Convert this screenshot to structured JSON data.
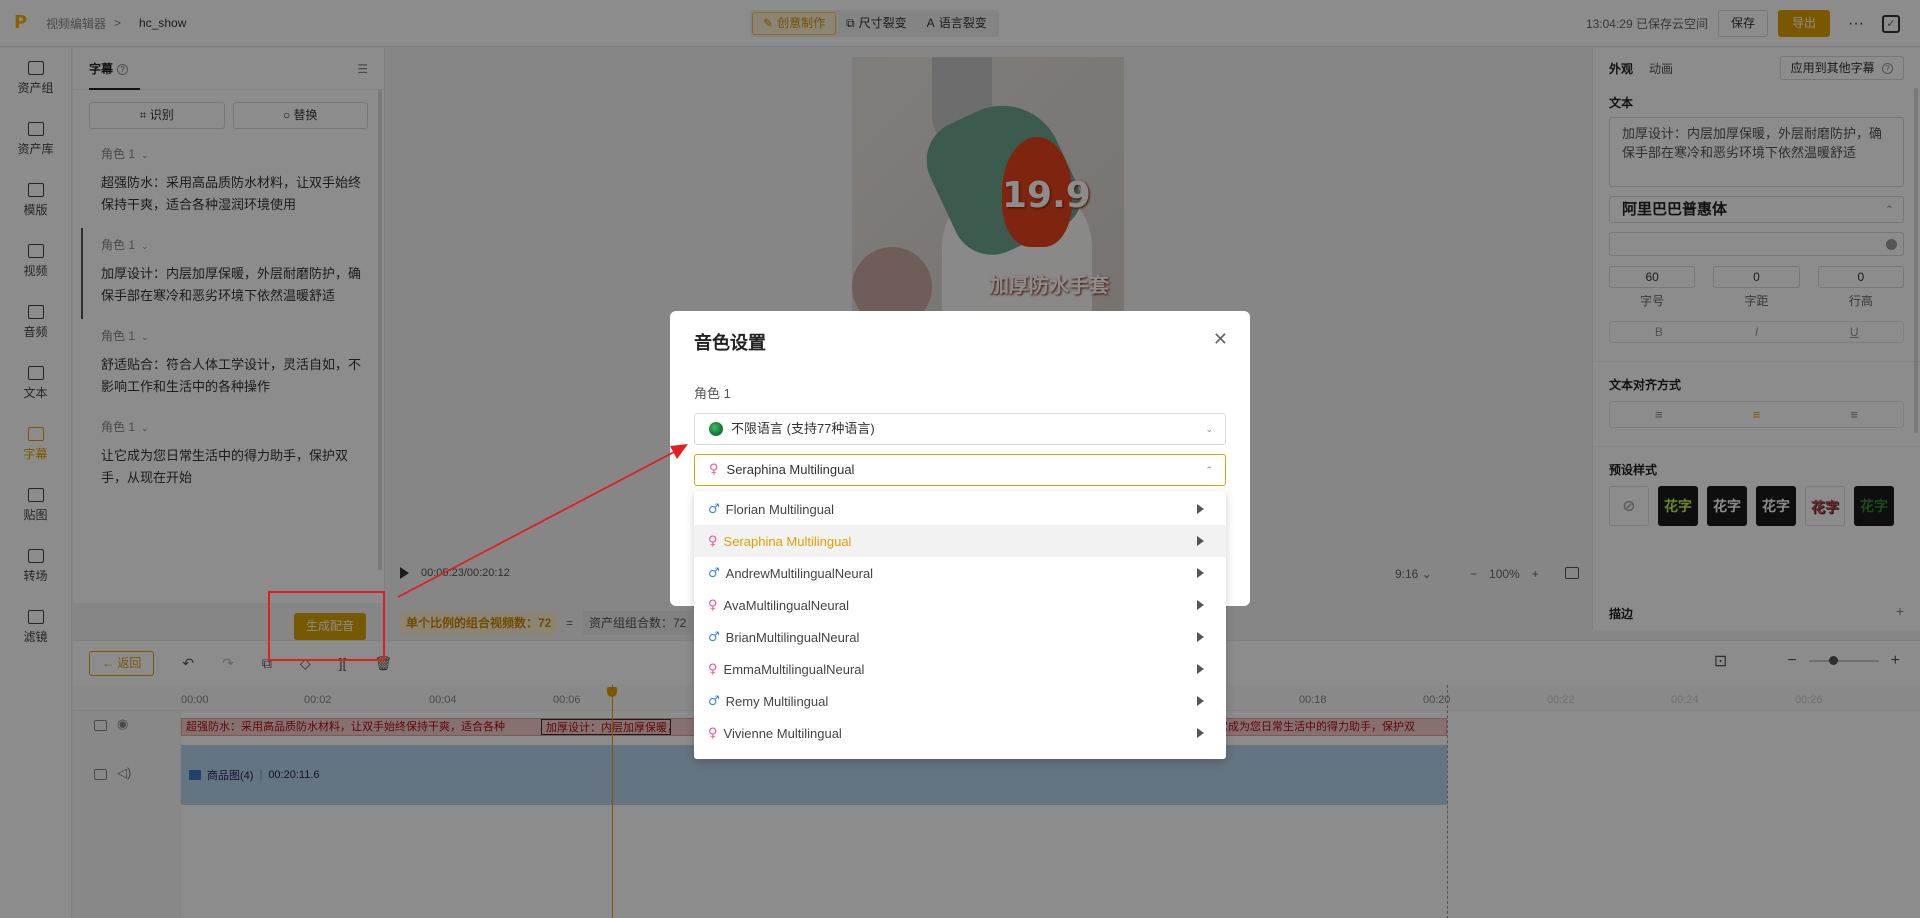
{
  "topbar": {
    "breadcrumb_root": "视频编辑器",
    "breadcrumb_sep": ">",
    "project_name": "hc_show",
    "mode_tabs": [
      {
        "label": "创意制作",
        "icon": "sparkle-icon",
        "active": true
      },
      {
        "label": "尺寸裂变",
        "icon": "resize-icon",
        "active": false
      },
      {
        "label": "语言裂变",
        "icon": "translate-icon",
        "active": false
      }
    ],
    "save_status": "13:04:29 已保存云空间",
    "save_label": "保存",
    "export_label": "导出",
    "more_label": "···"
  },
  "rail": [
    {
      "label": "资产组",
      "icon": "folder-icon"
    },
    {
      "label": "资产库",
      "icon": "library-icon"
    },
    {
      "label": "模版",
      "icon": "template-icon"
    },
    {
      "label": "视频",
      "icon": "film-icon"
    },
    {
      "label": "音频",
      "icon": "music-icon"
    },
    {
      "label": "文本",
      "icon": "text-icon"
    },
    {
      "label": "字幕",
      "icon": "subtitle-icon",
      "active": true
    },
    {
      "label": "贴图",
      "icon": "sticker-icon"
    },
    {
      "label": "转场",
      "icon": "transition-icon"
    },
    {
      "label": "滤镜",
      "icon": "filter-icon"
    }
  ],
  "subtitles": {
    "tab_label": "字幕",
    "recognize_label": "识别",
    "replace_label": "替换",
    "items": [
      {
        "role": "角色 1",
        "text": "超强防水：采用高品质防水材料，让双手始终保持干爽，适合各种湿润环境使用"
      },
      {
        "role": "角色 1",
        "text": "加厚设计：内层加厚保暖，外层耐磨防护，确保手部在寒冷和恶劣环境下依然温暖舒适"
      },
      {
        "role": "角色 1",
        "text": "舒适贴合：符合人体工学设计，灵活自如，不影响工作和生活中的各种操作"
      },
      {
        "role": "角色 1",
        "text": "让它成为您日常生活中的得力助手，保护双手，从现在开始"
      }
    ]
  },
  "preview": {
    "price_text": "19.9",
    "tag_text": "加厚防水手套",
    "timecode": "00:05:23/00:20:12",
    "ratio": "9:16",
    "zoom": "100%"
  },
  "right_panel": {
    "tab_appearance": "外观",
    "tab_animation": "动画",
    "apply_label": "应用到其他字幕",
    "text_label": "文本",
    "text_value": "加厚设计：内层加厚保暖，外层耐磨防护，确保手部在寒冷和恶劣环境下依然温暖舒适",
    "font_name": "阿里巴巴普惠体",
    "font_size": "60",
    "letter_spacing": "0",
    "line_height": "0",
    "font_size_label": "字号",
    "letter_spacing_label": "字距",
    "line_height_label": "行高",
    "bold": "B",
    "italic": "I",
    "underline": "U",
    "align_label": "文本对齐方式",
    "preset_label": "预设样式",
    "preset_text": "花字",
    "stroke_label": "描边"
  },
  "genbar": {
    "generate_label": "生成配音",
    "combo_label": "单个比例的组合视频数：72",
    "equals": "=",
    "asset_combo_label": "资产组组合数：72"
  },
  "timeline": {
    "back_label": "返回",
    "ruler": [
      "00:00",
      "00:02",
      "00:04",
      "00:06",
      "00:18",
      "00:20",
      "00:22",
      "00:24",
      "00:26"
    ],
    "sub_segments": [
      "超强防水：采用高品质防水材料，让双手始终保持干爽，适合各种",
      "加厚设计：内层加厚保暖，外",
      "它成为您日常生活中的得力助手，保护双"
    ],
    "media_label": "商品图(4)",
    "media_duration": "00:20:11.6"
  },
  "modal": {
    "title": "音色设置",
    "role_label": "角色 1",
    "language_value": "不限语言 (支持77种语言)",
    "voice_value": "Seraphina Multilingual",
    "options": [
      {
        "label": "Florian Multilingual",
        "gender": "male"
      },
      {
        "label": "Seraphina Multilingual",
        "gender": "female",
        "selected": true
      },
      {
        "label": "AndrewMultilingualNeural",
        "gender": "male"
      },
      {
        "label": "AvaMultilingualNeural",
        "gender": "female"
      },
      {
        "label": "BrianMultilingualNeural",
        "gender": "male"
      },
      {
        "label": "EmmaMultilingualNeural",
        "gender": "female"
      },
      {
        "label": "Remy Multilingual",
        "gender": "male"
      },
      {
        "label": "Vivienne Multilingual",
        "gender": "female"
      }
    ]
  },
  "colors": {
    "accent": "#e0a100",
    "annotation": "#e02020"
  }
}
